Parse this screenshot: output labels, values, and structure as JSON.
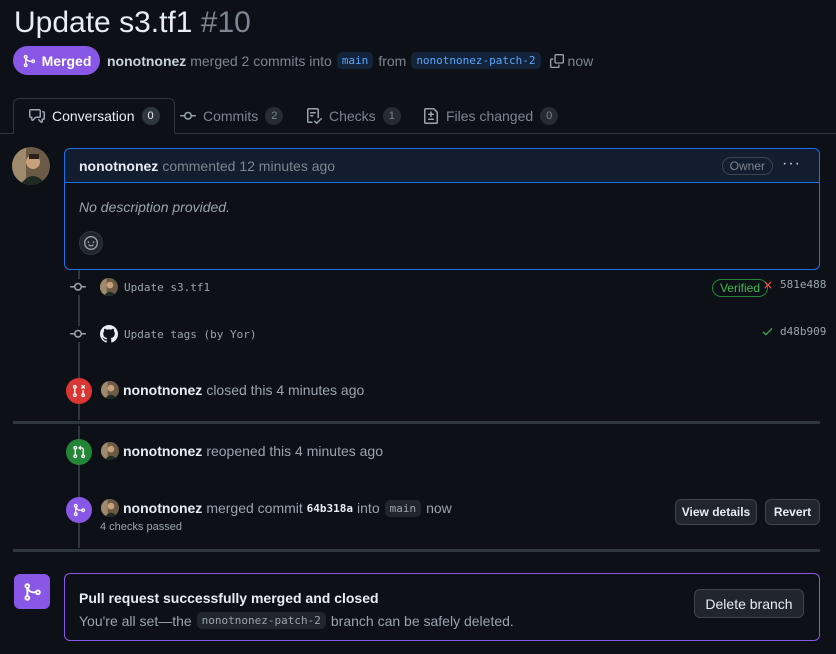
{
  "pr": {
    "title": "Update s3.tf1",
    "number": "#10",
    "state_label": "Merged",
    "author": "nonotnonez",
    "merge_summary": "merged 2 commits into",
    "base_branch": "main",
    "from_text": "from",
    "head_branch": "nonotnonez-patch-2",
    "time": "now"
  },
  "tabs": [
    {
      "label": "Conversation",
      "count": "0"
    },
    {
      "label": "Commits",
      "count": "2"
    },
    {
      "label": "Checks",
      "count": "1"
    },
    {
      "label": "Files changed",
      "count": "0"
    }
  ],
  "comment": {
    "author": "nonotnonez",
    "action": "commented 12 minutes ago",
    "role_badge": "Owner",
    "body": "No description provided."
  },
  "commits": [
    {
      "message": "Update s3.tf1",
      "verified_label": "Verified",
      "status": "fail",
      "sha": "581e488"
    },
    {
      "message": "Update tags (by Yor)",
      "status": "pass",
      "sha": "d48b909"
    }
  ],
  "events": {
    "closed": {
      "actor": "nonotnonez",
      "text": "closed this 4 minutes ago"
    },
    "reopened": {
      "actor": "nonotnonez",
      "text": "reopened this 4 minutes ago"
    },
    "merged": {
      "actor": "nonotnonez",
      "text_prefix": "merged commit",
      "commit_sha": "64b318a",
      "into_text": "into",
      "branch": "main",
      "time": "now",
      "checks": "4 checks passed",
      "view_details_label": "View details",
      "revert_label": "Revert"
    }
  },
  "merge_box": {
    "title": "Pull request successfully merged and closed",
    "sub_prefix": "You're all set—the",
    "branch": "nonotnonez-patch-2",
    "sub_suffix": "branch can be safely deleted.",
    "delete_label": "Delete branch"
  },
  "colors": {
    "merged": "#8957e5",
    "closed": "#da3633",
    "reopened": "#238636",
    "accent": "#1f6feb"
  }
}
